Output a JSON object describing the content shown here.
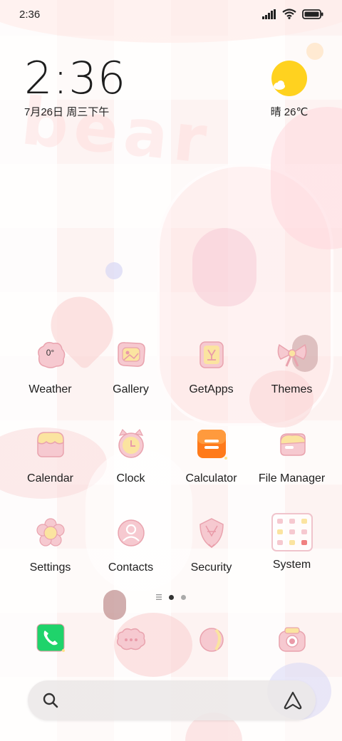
{
  "status_bar": {
    "time": "2:36"
  },
  "clock_widget": {
    "time": "2:36",
    "date": "7月26日 周三下午"
  },
  "weather_widget": {
    "text": "晴 26℃"
  },
  "wallpaper": {
    "text": "bear"
  },
  "apps": [
    {
      "label": "Weather",
      "icon": "weather-icon",
      "badge": "0°"
    },
    {
      "label": "Gallery",
      "icon": "gallery-icon"
    },
    {
      "label": "GetApps",
      "icon": "getapps-icon"
    },
    {
      "label": "Themes",
      "icon": "themes-icon"
    },
    {
      "label": "Calendar",
      "icon": "calendar-icon"
    },
    {
      "label": "Clock",
      "icon": "clock-icon"
    },
    {
      "label": "Calculator",
      "icon": "calculator-icon"
    },
    {
      "label": "File Manager",
      "icon": "file-manager-icon"
    },
    {
      "label": "Settings",
      "icon": "settings-icon"
    },
    {
      "label": "Contacts",
      "icon": "contacts-icon"
    },
    {
      "label": "Security",
      "icon": "security-icon"
    },
    {
      "label": "System",
      "icon": "system-folder-icon"
    }
  ],
  "dock": [
    {
      "icon": "phone-icon"
    },
    {
      "icon": "messages-icon"
    },
    {
      "icon": "browser-icon"
    },
    {
      "icon": "camera-icon"
    }
  ],
  "page_indicator": {
    "pages": 2,
    "current": 1
  },
  "colors": {
    "pink": "#f4c7cf",
    "pink_dark": "#e99aa8",
    "yellow": "#f8e08a",
    "sun": "#ffd21f",
    "orange": "#ff7a1a",
    "green": "#1fd36b"
  }
}
